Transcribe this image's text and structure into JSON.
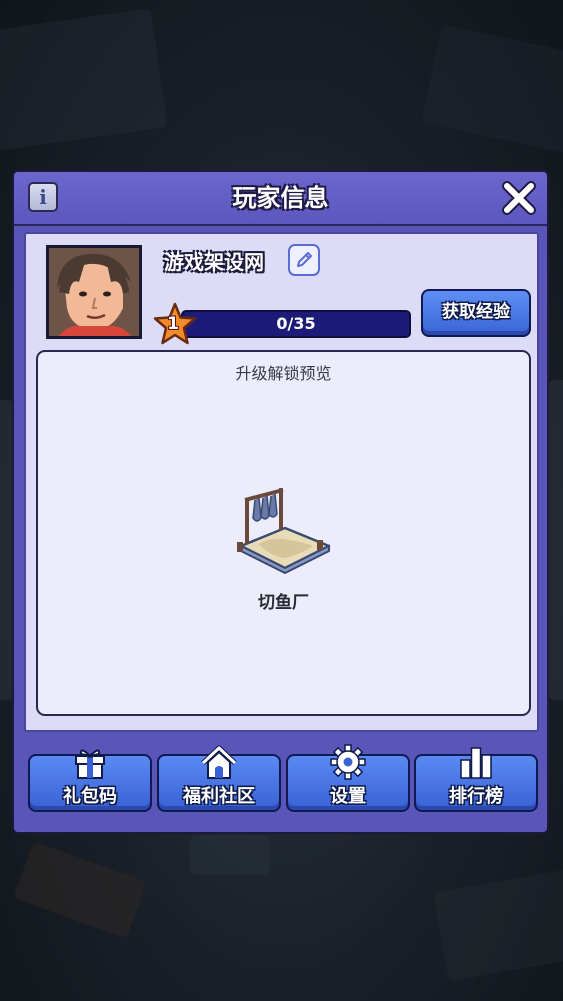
{
  "dialog": {
    "title": "玩家信息"
  },
  "player": {
    "name": "游戏架设网",
    "level": "1",
    "xp_text": "0/35",
    "xp_progress": 0
  },
  "buttons": {
    "get_xp": "获取经验"
  },
  "preview": {
    "title": "升级解锁预览",
    "item_name": "切鱼厂"
  },
  "nav": [
    {
      "label": "礼包码",
      "icon": "gift-icon"
    },
    {
      "label": "福利社区",
      "icon": "house-icon"
    },
    {
      "label": "设置",
      "icon": "gear-icon"
    },
    {
      "label": "排行榜",
      "icon": "leaderboard-icon"
    }
  ],
  "colors": {
    "panel": "#5a55b8",
    "inner": "#dcdcf6",
    "button_blue": "#3a64d6",
    "xp_bar": "#1c1c78",
    "star": "#f08a2a"
  }
}
